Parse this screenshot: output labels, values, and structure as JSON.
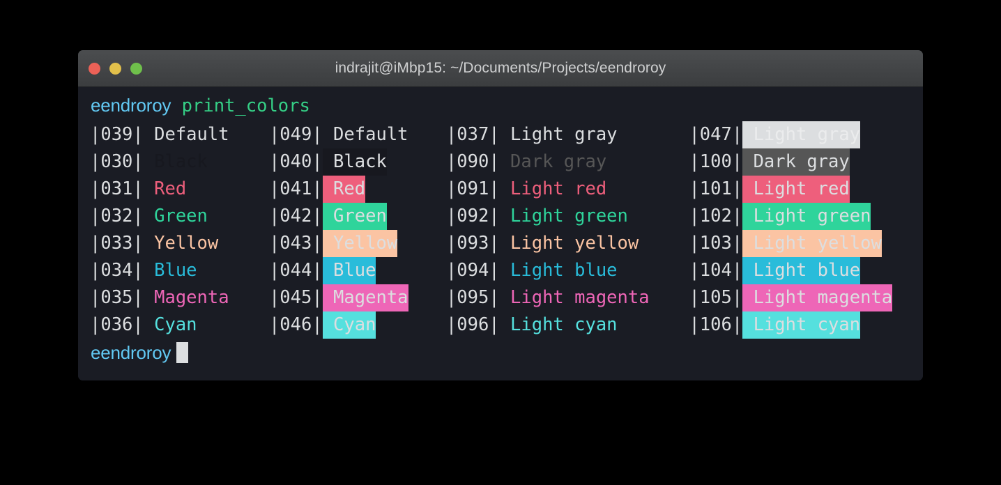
{
  "window": {
    "title": "indrajit@iMbp15: ~/Documents/Projects/eendroroy",
    "traffic_lights": [
      {
        "name": "close",
        "color": "#ec6157"
      },
      {
        "name": "minimize",
        "color": "#e2c04b"
      },
      {
        "name": "maximize",
        "color": "#6fc04b"
      }
    ]
  },
  "theme": {
    "title_bar_bg": "#3f4143",
    "terminal_bg": "#1a1c24",
    "default_fg": "#dcdee0",
    "prompt_fg": "#62c9f3",
    "command_fg": "#35cf86",
    "cursor_bg": "#dcdee0"
  },
  "terminal": {
    "prompt_top": {
      "user": "eendroroy",
      "command": "print_colors"
    },
    "prompt_bottom": {
      "user": "eendroroy",
      "command": ""
    }
  },
  "color_table": {
    "rows": [
      [
        {
          "code": "|039|",
          "label": "Default",
          "fg": "#dcdee0",
          "bg": "transparent"
        },
        {
          "code": "|049|",
          "label": "Default",
          "fg": "#dcdee0",
          "bg": "transparent"
        },
        {
          "code": "|037|",
          "label": "Light gray",
          "fg": "#dcdee0",
          "bg": "transparent"
        },
        {
          "code": "|047|",
          "label": "Light gray",
          "fg": "#ebeced",
          "bg": "#dcdee0"
        }
      ],
      [
        {
          "code": "|030|",
          "label": "Black",
          "fg": "#17181f",
          "bg": "transparent"
        },
        {
          "code": "|040|",
          "label": "Black",
          "fg": "#dcdee0",
          "bg": "#17181f"
        },
        {
          "code": "|090|",
          "label": "Dark gray",
          "fg": "#565656",
          "bg": "transparent"
        },
        {
          "code": "|100|",
          "label": "Dark gray",
          "fg": "#dcdee0",
          "bg": "#565656"
        }
      ],
      [
        {
          "code": "|031|",
          "label": "Red",
          "fg": "#ee5f7c",
          "bg": "transparent"
        },
        {
          "code": "|041|",
          "label": "Red",
          "fg": "#dcdee0",
          "bg": "#ee5f7c"
        },
        {
          "code": "|091|",
          "label": "Light red",
          "fg": "#ee5f7c",
          "bg": "transparent"
        },
        {
          "code": "|101|",
          "label": "Light red",
          "fg": "#dcdee0",
          "bg": "#ee5f7c"
        }
      ],
      [
        {
          "code": "|032|",
          "label": "Green",
          "fg": "#2fd49b",
          "bg": "transparent"
        },
        {
          "code": "|042|",
          "label": "Green",
          "fg": "#dcdee0",
          "bg": "#2fd49b"
        },
        {
          "code": "|092|",
          "label": "Light green",
          "fg": "#2fd49b",
          "bg": "transparent"
        },
        {
          "code": "|102|",
          "label": "Light green",
          "fg": "#dcdee0",
          "bg": "#2fd49b"
        }
      ],
      [
        {
          "code": "|033|",
          "label": "Yellow",
          "fg": "#fbc4a3",
          "bg": "transparent"
        },
        {
          "code": "|043|",
          "label": "Yellow",
          "fg": "#dcdee0",
          "bg": "#fbc4a3"
        },
        {
          "code": "|093|",
          "label": "Light yellow",
          "fg": "#fbc4a3",
          "bg": "transparent"
        },
        {
          "code": "|103|",
          "label": "Light yellow",
          "fg": "#dcdee0",
          "bg": "#fbc4a3"
        }
      ],
      [
        {
          "code": "|034|",
          "label": "Blue",
          "fg": "#29bcda",
          "bg": "transparent"
        },
        {
          "code": "|044|",
          "label": "Blue",
          "fg": "#dcdee0",
          "bg": "#29bcda"
        },
        {
          "code": "|094|",
          "label": "Light blue",
          "fg": "#29bcda",
          "bg": "transparent"
        },
        {
          "code": "|104|",
          "label": "Light blue",
          "fg": "#dcdee0",
          "bg": "#29bcda"
        }
      ],
      [
        {
          "code": "|035|",
          "label": "Magenta",
          "fg": "#ee66b7",
          "bg": "transparent"
        },
        {
          "code": "|045|",
          "label": "Magenta",
          "fg": "#dcdee0",
          "bg": "#ee66b7"
        },
        {
          "code": "|095|",
          "label": "Light magenta",
          "fg": "#ee66b7",
          "bg": "transparent"
        },
        {
          "code": "|105|",
          "label": "Light magenta",
          "fg": "#dcdee0",
          "bg": "#ee66b7"
        }
      ],
      [
        {
          "code": "|036|",
          "label": "Cyan",
          "fg": "#55e0de",
          "bg": "transparent"
        },
        {
          "code": "|046|",
          "label": "Cyan",
          "fg": "#dcdee0",
          "bg": "#55e0de"
        },
        {
          "code": "|096|",
          "label": "Light cyan",
          "fg": "#55e0de",
          "bg": "transparent"
        },
        {
          "code": "|106|",
          "label": "Light cyan",
          "fg": "#dcdee0",
          "bg": "#55e0de"
        }
      ]
    ]
  }
}
